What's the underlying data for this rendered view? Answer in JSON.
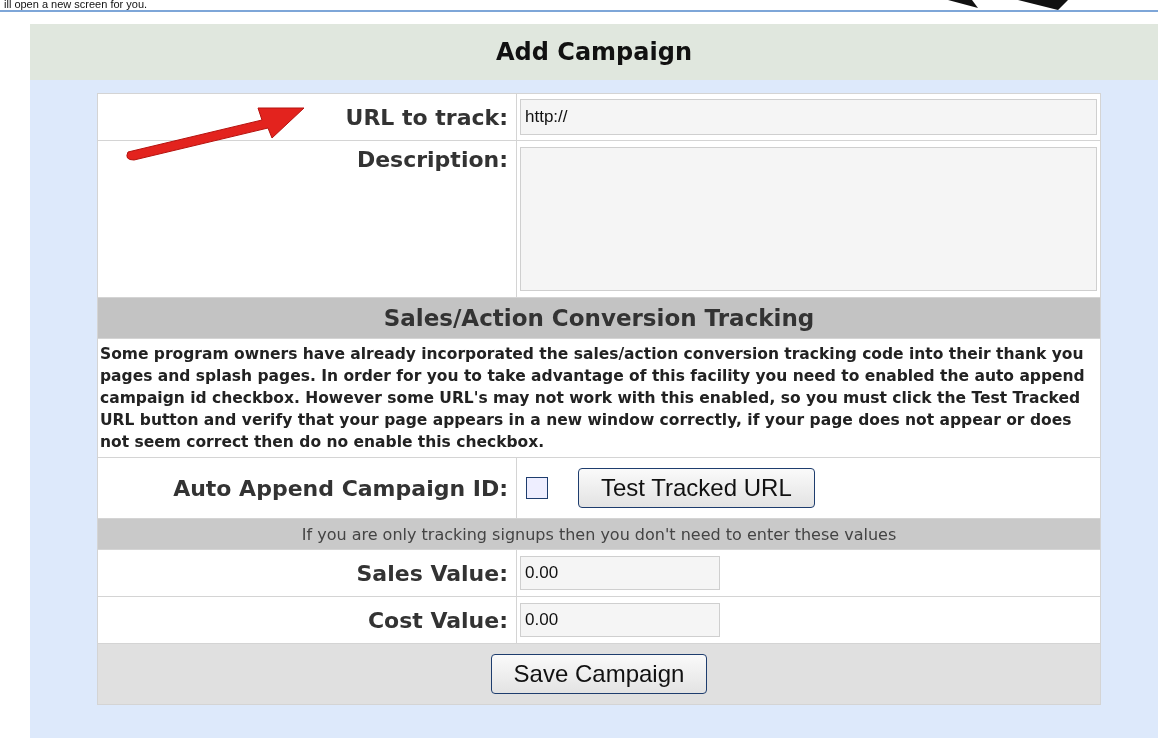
{
  "top_text": "ill open a new screen for you.",
  "title": "Add Campaign",
  "url_field": {
    "label": "URL to track:",
    "value": "http://"
  },
  "description_field": {
    "label": "Description:"
  },
  "section_title": "Sales/Action Conversion Tracking",
  "explanation": "Some program owners have already incorporated the sales/action conversion tracking code into their thank you pages and splash pages. In order for you to take advantage of this facility you need to enabled the auto append campaign id checkbox. However some URL's may not work with this enabled, so you must click the Test Tracked URL button and verify that your page appears in a new window correctly, if your page does not appear or does not seem correct then do no enable this checkbox.",
  "auto_append": {
    "label": "Auto Append Campaign ID:",
    "checked": false,
    "button": "Test Tracked URL"
  },
  "note": "If you are only tracking signups then you don't need to enter these values",
  "value_fields": [
    {
      "label": "Sales Value:",
      "value": "0.00"
    },
    {
      "label": "Cost Value:",
      "value": "0.00"
    }
  ],
  "save_button": "Save Campaign"
}
